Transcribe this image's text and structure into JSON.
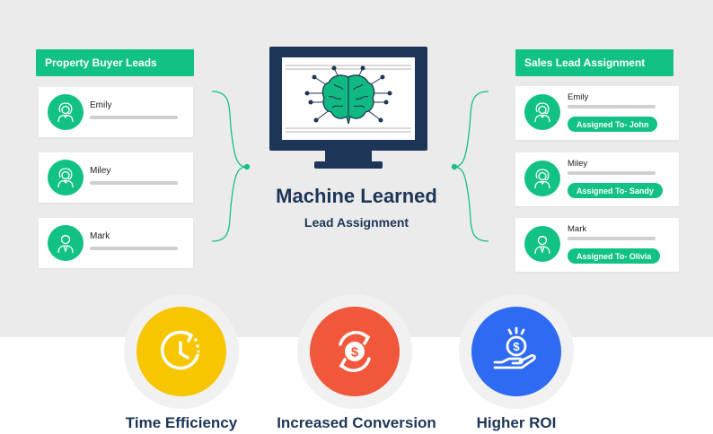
{
  "left": {
    "header": "Property Buyer Leads",
    "leads": [
      {
        "name": "Emily",
        "gender": "female"
      },
      {
        "name": "Miley",
        "gender": "female"
      },
      {
        "name": "Mark",
        "gender": "male"
      }
    ]
  },
  "right": {
    "header": "Sales Lead Assignment",
    "leads": [
      {
        "name": "Emily",
        "assigned": "Assigned To- John",
        "gender": "female"
      },
      {
        "name": "Miley",
        "assigned": "Assigned To- Sandy",
        "gender": "female"
      },
      {
        "name": "Mark",
        "assigned": "Assigned To- Olivia",
        "gender": "male"
      }
    ]
  },
  "center": {
    "title": "Machine Learned",
    "subtitle": "Lead Assignment",
    "icon": "brain-circuit-icon"
  },
  "features": [
    {
      "label": "Time Efficiency",
      "icon": "clock-refresh-icon",
      "color": "#f7c600"
    },
    {
      "label": "Increased Conversion",
      "icon": "dollar-cycle-icon",
      "color": "#f0573b"
    },
    {
      "label": "Higher ROI",
      "icon": "hand-coin-icon",
      "color": "#2f6bf2"
    }
  ],
  "colors": {
    "accent": "#12c184",
    "navy": "#1d3557",
    "panel": "#ebebeb",
    "brain": "#10b981"
  }
}
